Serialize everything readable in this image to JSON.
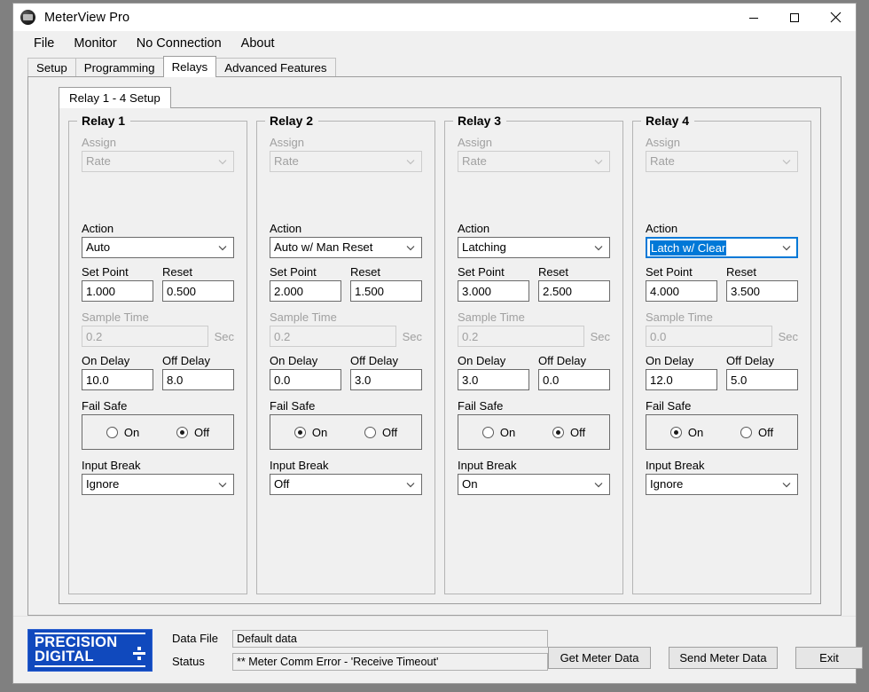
{
  "window": {
    "title": "MeterView Pro",
    "app_icon": "app-logo-icon",
    "controls": {
      "minimize": "minimize-icon",
      "maximize": "maximize-icon",
      "close": "close-icon"
    }
  },
  "menubar": {
    "items": [
      "File",
      "Monitor",
      "No Connection",
      "About"
    ]
  },
  "tabs": {
    "items": [
      "Setup",
      "Programming",
      "Relays",
      "Advanced Features"
    ],
    "active": "Relays"
  },
  "inner_tabs": {
    "items": [
      "Relay 1 - 4 Setup"
    ],
    "active": "Relay 1 - 4 Setup"
  },
  "labels": {
    "assign": "Assign",
    "action": "Action",
    "set_point": "Set Point",
    "reset": "Reset",
    "sample_time": "Sample Time",
    "sec": "Sec",
    "on_delay": "On Delay",
    "off_delay": "Off Delay",
    "fail_safe": "Fail Safe",
    "input_break": "Input Break",
    "radio_on": "On",
    "radio_off": "Off"
  },
  "relays": [
    {
      "title": "Relay 1",
      "assign": "Rate",
      "action": "Auto",
      "action_focused": false,
      "set_point": "1.000",
      "reset": "0.500",
      "sample_time": "0.2",
      "on_delay": "10.0",
      "off_delay": "8.0",
      "fail_safe": "Off",
      "input_break": "Ignore"
    },
    {
      "title": "Relay 2",
      "assign": "Rate",
      "action": "Auto w/ Man Reset",
      "action_focused": false,
      "set_point": "2.000",
      "reset": "1.500",
      "sample_time": "0.2",
      "on_delay": "0.0",
      "off_delay": "3.0",
      "fail_safe": "On",
      "input_break": "Off"
    },
    {
      "title": "Relay 3",
      "assign": "Rate",
      "action": "Latching",
      "action_focused": false,
      "set_point": "3.000",
      "reset": "2.500",
      "sample_time": "0.2",
      "on_delay": "3.0",
      "off_delay": "0.0",
      "fail_safe": "Off",
      "input_break": "On"
    },
    {
      "title": "Relay 4",
      "assign": "Rate",
      "action": "Latch w/ Clear",
      "action_focused": true,
      "set_point": "4.000",
      "reset": "3.500",
      "sample_time": "0.0",
      "on_delay": "12.0",
      "off_delay": "5.0",
      "fail_safe": "On",
      "input_break": "Ignore"
    }
  ],
  "footer": {
    "logo": {
      "line1": "PRECISION",
      "line2": "DIGITAL"
    },
    "data_file_label": "Data File",
    "data_file_value": "Default data",
    "status_label": "Status",
    "status_value": "** Meter Comm Error - 'Receive Timeout'",
    "buttons": {
      "get": "Get Meter Data",
      "send": "Send Meter Data",
      "exit": "Exit"
    }
  },
  "colors": {
    "accent_focus": "#0078d7",
    "logo_blue": "#1049bd",
    "desktop": "#808080"
  }
}
